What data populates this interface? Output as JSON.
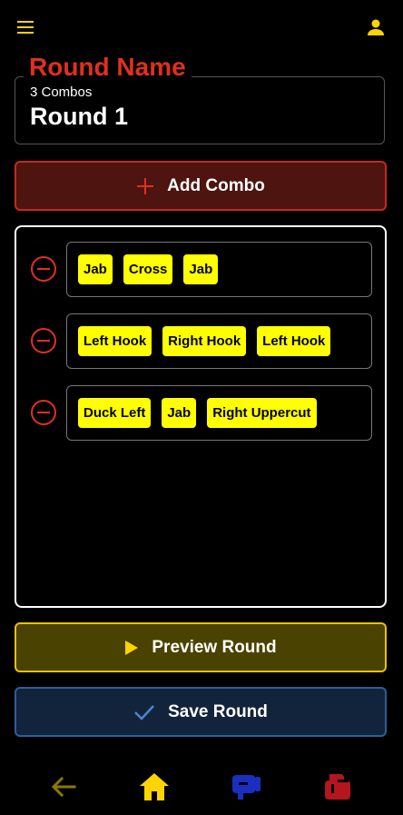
{
  "colors": {
    "accent_red": "#e0301e",
    "accent_yellow": "#ffff00",
    "preview_border": "#e6c400",
    "save_border": "#2e5e9c",
    "nav_back": "#8a7a00",
    "nav_home": "#ffd400",
    "nav_blue": "#1a2fbf",
    "nav_red": "#b3161c"
  },
  "topbar": {
    "menu_icon": "hamburger-icon",
    "profile_icon": "person-icon"
  },
  "round": {
    "legend": "Round Name",
    "combo_count": "3 Combos",
    "name": "Round 1"
  },
  "actions": {
    "add_combo": "Add Combo",
    "preview": "Preview Round",
    "save": "Save Round"
  },
  "combos": [
    {
      "moves": [
        "Jab",
        "Cross",
        "Jab"
      ]
    },
    {
      "moves": [
        "Left Hook",
        "Right Hook",
        "Left Hook"
      ]
    },
    {
      "moves": [
        "Duck Left",
        "Jab",
        "Right Uppercut"
      ]
    }
  ],
  "bottom_nav": {
    "items": [
      {
        "icon": "back-arrow-icon"
      },
      {
        "icon": "home-icon"
      },
      {
        "icon": "boxing-glove-blue-icon"
      },
      {
        "icon": "boxing-glove-red-icon"
      }
    ]
  }
}
